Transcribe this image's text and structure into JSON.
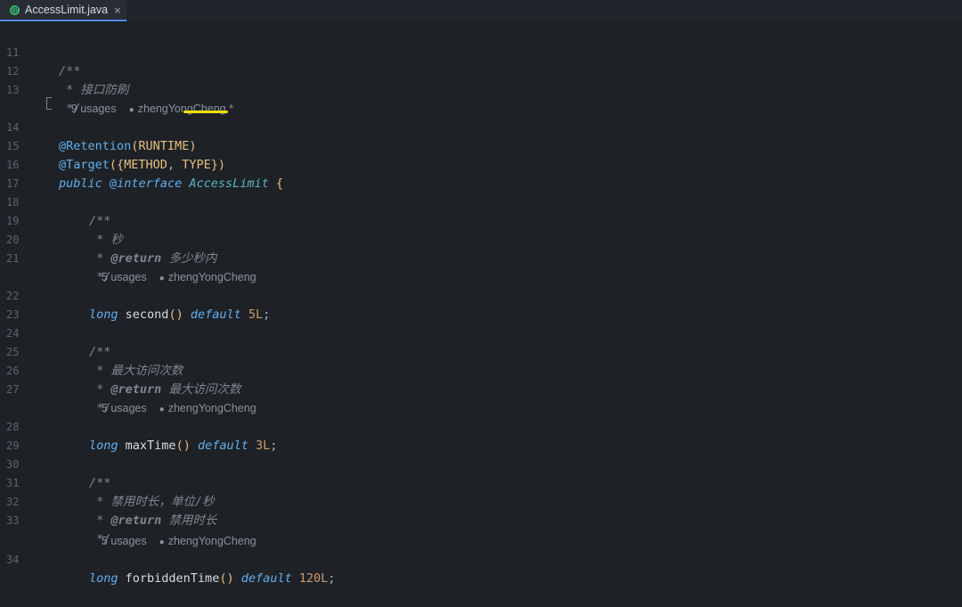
{
  "tab": {
    "title": "AccessLimit.java",
    "close": "×"
  },
  "lines": [
    {
      "n": "11",
      "text": "/**"
    },
    {
      "n": "12",
      "text": " * 接口防刷"
    },
    {
      "n": "13",
      "text": " */"
    },
    {
      "hint": {
        "usages": "9 usages",
        "author": "zhengYongCheng *"
      }
    },
    {
      "n": "14",
      "ann": "@Retention",
      "arg": "RUNTIME"
    },
    {
      "n": "15",
      "ann": "@Target",
      "args": [
        "METHOD",
        "TYPE"
      ]
    },
    {
      "n": "16",
      "kw": "public",
      "at": "@",
      "kw2": "interface",
      "name": "AccessLimit",
      "brace": "{"
    },
    {
      "n": "17",
      "text": ""
    },
    {
      "n": "18",
      "text": "/**"
    },
    {
      "n": "19",
      "text": " * 秒"
    },
    {
      "n": "20",
      "tag": "@return",
      "text": "多少秒内"
    },
    {
      "n": "21",
      "text": " */"
    },
    {
      "hint": {
        "usages": "5 usages",
        "author": "zhengYongCheng"
      }
    },
    {
      "n": "22",
      "type": "long",
      "method": "second",
      "def": "default",
      "value": "5L"
    },
    {
      "n": "23",
      "text": ""
    },
    {
      "n": "24",
      "text": "/**"
    },
    {
      "n": "25",
      "text": " * 最大访问次数"
    },
    {
      "n": "26",
      "tag": "@return",
      "text": "最大访问次数"
    },
    {
      "n": "27",
      "text": " */"
    },
    {
      "hint": {
        "usages": "5 usages",
        "author": "zhengYongCheng"
      }
    },
    {
      "n": "28",
      "type": "long",
      "method": "maxTime",
      "def": "default",
      "value": "3L"
    },
    {
      "n": "29",
      "text": ""
    },
    {
      "n": "30",
      "text": "/**"
    },
    {
      "n": "31",
      "text": " * 禁用时长，单位/秒"
    },
    {
      "n": "32",
      "tag": "@return",
      "text": "禁用时长"
    },
    {
      "n": "33",
      "text": " */"
    },
    {
      "hint": {
        "usages": "5 usages",
        "author": "zhengYongCheng"
      }
    },
    {
      "n": "34",
      "type": "long",
      "method": "forbiddenTime",
      "def": "default",
      "value": "120L"
    }
  ],
  "colors": {
    "accent": "#568af2",
    "highlight": "#f0e000"
  }
}
